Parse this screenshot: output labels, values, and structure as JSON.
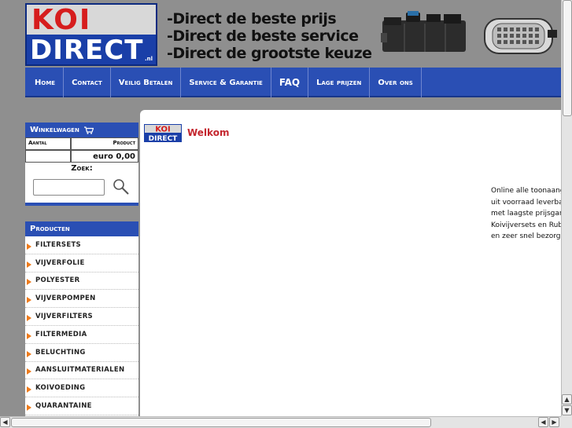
{
  "logo": {
    "line1": "KOI",
    "line2": "DIRECT",
    "suffix": ".nl"
  },
  "slogans": [
    "-Direct de beste prijs",
    "-Direct de beste service",
    "-Direct de grootste keuze"
  ],
  "nav": [
    {
      "label": "Home"
    },
    {
      "label": "Contact"
    },
    {
      "label": "Veilig Betalen"
    },
    {
      "label": "Service & Garantie"
    },
    {
      "label": "FAQ"
    },
    {
      "label": "Lage prijzen"
    },
    {
      "label": "Over ons"
    }
  ],
  "cart": {
    "title": "Winkelwagen",
    "col_amount": "Aantal",
    "col_product": "Product",
    "total": "euro 0,00",
    "search_label": "Zoek:",
    "search_value": ""
  },
  "products": {
    "title": "Producten",
    "items": [
      "FILTERSETS",
      "VIJVERFOLIE",
      "POLYESTER",
      "VIJVERPOMPEN",
      "VIJVERFILTERS",
      "FILTERMEDIA",
      "BELUCHTING",
      "AANSLUITMATERIALEN",
      "KOIVOEDING",
      "QUARANTAINE"
    ]
  },
  "content": {
    "mini_logo_top": "KOI",
    "mini_logo_bottom": "DIRECT",
    "heading": "Welkom",
    "intro_lines": [
      "Online alle toonaang",
      "uit voorraad leverba",
      "met laagste prijsgara",
      "Koivijversets en Rub",
      "en zeer snel bezorg"
    ]
  },
  "colors": {
    "nav_blue": "#2a4fb4",
    "logo_red": "#d61d1d",
    "heading_red": "#c4262e",
    "arrow_orange": "#ee7b1c"
  }
}
